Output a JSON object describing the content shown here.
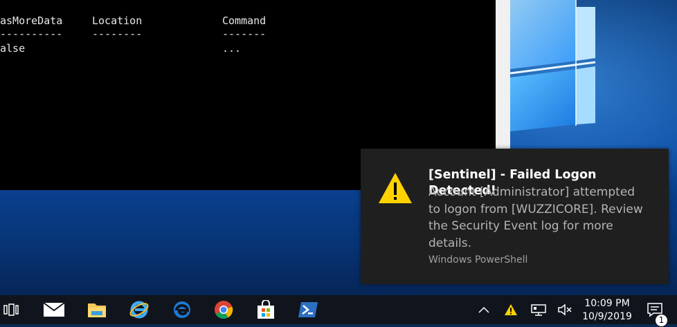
{
  "terminal": {
    "headers": [
      "asMoreData",
      "Location",
      "Command"
    ],
    "separators": [
      "----------",
      "--------",
      "-------"
    ],
    "row": [
      "alse",
      "",
      "..."
    ]
  },
  "toast": {
    "title": "[Sentinel] - Failed Logon Detected!",
    "body": "Account [Administrator] attempted to logon from [WUZZICORE]. Review the Security Event log for more details.",
    "source": "Windows PowerShell",
    "icon": "warning-icon"
  },
  "taskbar": {
    "pinned": [
      "task-view-icon",
      "mail-icon",
      "file-explorer-icon",
      "internet-explorer-icon",
      "edge-icon",
      "chrome-icon",
      "store-icon",
      "powershell-icon"
    ],
    "tray": [
      "chevron-up-icon",
      "warning-icon",
      "network-icon",
      "volume-muted-icon"
    ],
    "time": "10:09 PM",
    "date": "10/9/2019",
    "notification_count": "1"
  },
  "colors": {
    "warning": "#ffd200",
    "taskbar": "#10151d",
    "toast_bg": "#1f1f1f"
  }
}
